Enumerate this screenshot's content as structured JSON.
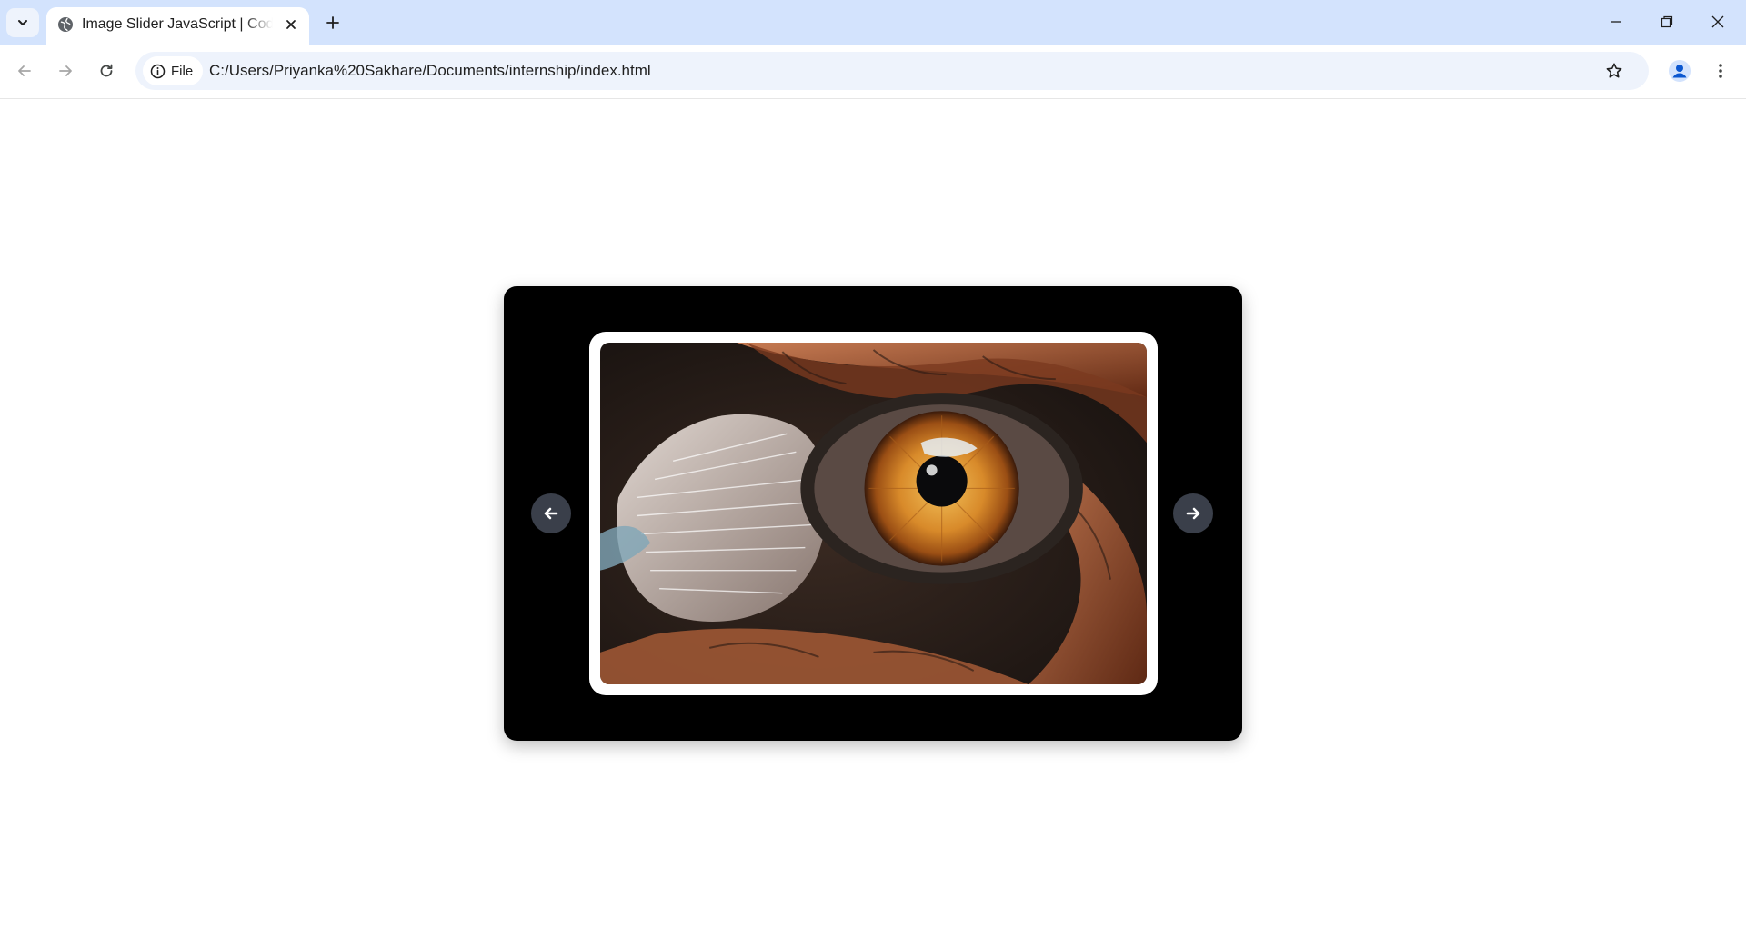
{
  "browser": {
    "tab_title": "Image Slider JavaScript | Coding",
    "address_chip_label": "File",
    "url": "C:/Users/Priyanka%20Sakhare/Documents/internship/index.html",
    "accent_color": "#d3e3fd"
  },
  "icons": {
    "tab_search": "chevron-down-icon",
    "favicon": "globe-icon",
    "tab_close": "close-icon",
    "new_tab": "plus-icon",
    "minimize": "minimize-icon",
    "restore": "restore-icon",
    "close": "close-icon",
    "back": "arrow-left-icon",
    "forward": "arrow-right-icon",
    "reload": "reload-icon",
    "site_info": "info-icon",
    "bookmark": "star-icon",
    "profile": "avatar-icon",
    "menu": "kebab-menu-icon"
  },
  "slider": {
    "image_subject": "close-up of a bird of prey eye with orange iris and patterned feathers",
    "prev_button_icon": "arrow-left-icon",
    "next_button_icon": "arrow-right-icon",
    "background_color": "#000000",
    "button_color": "#3a3f4a"
  }
}
